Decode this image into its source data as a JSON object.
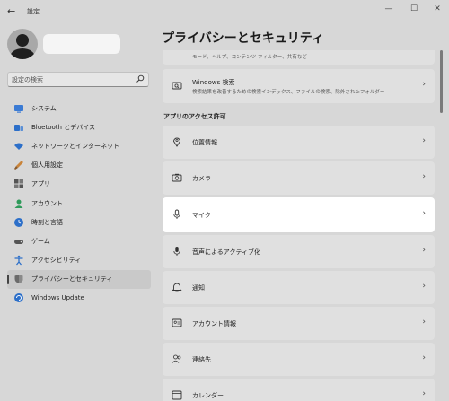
{
  "window": {
    "title": "設定",
    "back_icon": "←",
    "minimize_icon": "—",
    "maximize_icon": "☐",
    "close_icon": "✕"
  },
  "sidebar": {
    "search_placeholder": "設定の検索",
    "items": [
      {
        "label": "システム",
        "icon": "system-icon",
        "color": "#3b7bd4"
      },
      {
        "label": "Bluetooth とデバイス",
        "icon": "bluetooth-icon",
        "color": "#2c6fc9"
      },
      {
        "label": "ネットワークとインターネット",
        "icon": "wifi-icon",
        "color": "#2c6fc9"
      },
      {
        "label": "個人用設定",
        "icon": "brush-icon",
        "color": "#c9843a"
      },
      {
        "label": "アプリ",
        "icon": "apps-icon",
        "color": "#555555"
      },
      {
        "label": "アカウント",
        "icon": "account-icon",
        "color": "#2e9a5a"
      },
      {
        "label": "時刻と言語",
        "icon": "clock-globe-icon",
        "color": "#2c6fc9"
      },
      {
        "label": "ゲーム",
        "icon": "gamepad-icon",
        "color": "#555555"
      },
      {
        "label": "アクセシビリティ",
        "icon": "accessibility-icon",
        "color": "#2c6fc9"
      },
      {
        "label": "プライバシーとセキュリティ",
        "icon": "shield-icon",
        "color": "#6b6b6b",
        "active": true
      },
      {
        "label": "Windows Update",
        "icon": "windows-update-icon",
        "color": "#2c6fc9"
      }
    ]
  },
  "main": {
    "title": "プライバシーとセキュリティ",
    "partial_card_desc": "モード、ヘルプ、コンテンツ フィルター、共有など",
    "windows_search": {
      "label": "Windows 検索",
      "desc": "検索結果を改善するための検索インデックス、ファイルの検索、除外されたフォルダー"
    },
    "section_header": "アプリのアクセス許可",
    "permissions": [
      {
        "label": "位置情報",
        "icon": "location-icon"
      },
      {
        "label": "カメラ",
        "icon": "camera-icon"
      },
      {
        "label": "マイク",
        "icon": "microphone-icon",
        "highlight": true
      },
      {
        "label": "音声によるアクティブ化",
        "icon": "voice-activation-icon"
      },
      {
        "label": "通知",
        "icon": "bell-icon"
      },
      {
        "label": "アカウント情報",
        "icon": "account-info-icon"
      },
      {
        "label": "連絡先",
        "icon": "contacts-icon"
      },
      {
        "label": "カレンダー",
        "icon": "calendar-icon"
      }
    ],
    "chevron": "›"
  }
}
